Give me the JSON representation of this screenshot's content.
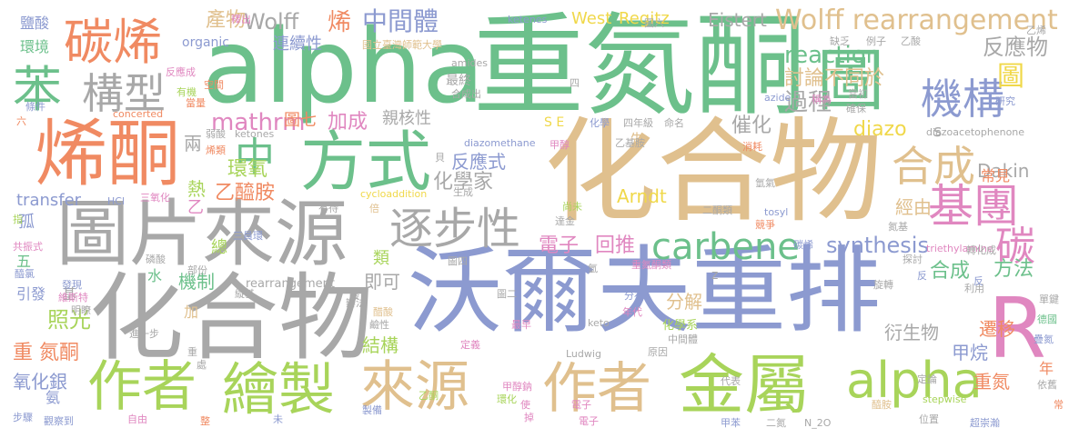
{
  "colors": {
    "green": "#6cc08b",
    "tan": "#e0c08e",
    "blue": "#8c9ad0",
    "gray": "#a8a8a8",
    "orange": "#f08a62",
    "pink": "#e087c0",
    "lime": "#a8d45a",
    "yellow": "#f0d84a"
  },
  "words": [
    {
      "text": "alpha",
      "color": "green"
    },
    {
      "text": "重氮酮",
      "color": "green"
    },
    {
      "text": "圖",
      "color": "green"
    },
    {
      "text": "化合物",
      "color": "tan"
    },
    {
      "text": "沃爾夫重排",
      "color": "blue"
    },
    {
      "text": "化合物",
      "color": "gray"
    },
    {
      "text": "圖片來源",
      "color": "gray"
    },
    {
      "text": "烯酮",
      "color": "orange"
    },
    {
      "text": "方式",
      "color": "green"
    },
    {
      "text": "碳烯",
      "color": "orange"
    },
    {
      "text": "苯",
      "color": "green"
    },
    {
      "text": "構型",
      "color": "gray"
    },
    {
      "text": "作者",
      "color": "lime"
    },
    {
      "text": "繪製",
      "color": "lime"
    },
    {
      "text": "來源",
      "color": "tan"
    },
    {
      "text": "作者",
      "color": "tan"
    },
    {
      "text": "金屬",
      "color": "lime"
    },
    {
      "text": "alpha",
      "color": "lime"
    },
    {
      "text": "R",
      "color": "pink"
    },
    {
      "text": "基團",
      "color": "pink"
    },
    {
      "text": "合成",
      "color": "tan"
    },
    {
      "text": "機構",
      "color": "blue"
    },
    {
      "text": "逐步性",
      "color": "gray"
    },
    {
      "text": "中",
      "color": "green"
    },
    {
      "text": "carbene",
      "color": "green"
    },
    {
      "text": "Wolff rearrangement",
      "color": "tan"
    },
    {
      "text": "碳",
      "color": "pink"
    },
    {
      "text": "反應物",
      "color": "gray"
    },
    {
      "text": "圖",
      "color": "yellow"
    },
    {
      "text": "Wolff",
      "color": "gray"
    },
    {
      "text": "產物",
      "color": "tan"
    },
    {
      "text": "烯",
      "color": "orange"
    },
    {
      "text": "中間體",
      "color": "blue"
    },
    {
      "text": "West",
      "color": "yellow"
    },
    {
      "text": "Regitz",
      "color": "yellow"
    },
    {
      "text": "Eistert",
      "color": "gray"
    },
    {
      "text": "reaction",
      "color": "green"
    },
    {
      "text": "mathrm",
      "color": "pink"
    },
    {
      "text": "加成",
      "color": "pink"
    },
    {
      "text": "過程",
      "color": "gray"
    },
    {
      "text": "討論不同於",
      "color": "tan"
    },
    {
      "text": "催化",
      "color": "gray"
    },
    {
      "text": "diazo",
      "color": "yellow"
    },
    {
      "text": "Dakin",
      "color": "gray"
    },
    {
      "text": "synthesis",
      "color": "blue"
    },
    {
      "text": "電子",
      "color": "pink"
    },
    {
      "text": "回推",
      "color": "pink"
    },
    {
      "text": "化學家",
      "color": "gray"
    },
    {
      "text": "反應式",
      "color": "blue"
    },
    {
      "text": "乙醯胺",
      "color": "orange"
    },
    {
      "text": "環氧",
      "color": "lime"
    },
    {
      "text": "Arndt",
      "color": "yellow"
    },
    {
      "text": "合成",
      "color": "green"
    },
    {
      "text": "方法",
      "color": "green"
    },
    {
      "text": "transfer",
      "color": "blue"
    },
    {
      "text": "照光",
      "color": "lime"
    },
    {
      "text": "重 氮酮",
      "color": "orange"
    },
    {
      "text": "氧化銀",
      "color": "blue"
    },
    {
      "text": "機制",
      "color": "green"
    },
    {
      "text": "即可",
      "color": "gray"
    },
    {
      "text": "分解",
      "color": "tan"
    },
    {
      "text": "結構",
      "color": "lime"
    },
    {
      "text": "衍生物",
      "color": "gray"
    },
    {
      "text": "甲烷",
      "color": "blue"
    },
    {
      "text": "遷移",
      "color": "orange"
    },
    {
      "text": "重氮",
      "color": "orange"
    },
    {
      "text": "常見",
      "color": "orange"
    },
    {
      "text": "經由",
      "color": "tan"
    },
    {
      "text": "環境",
      "color": "green"
    },
    {
      "text": "鹽酸",
      "color": "blue"
    },
    {
      "text": "連續性",
      "color": "blue"
    },
    {
      "text": "國立臺灣師範大學",
      "color": "tan"
    },
    {
      "text": "organic",
      "color": "blue"
    },
    {
      "text": "親核性",
      "color": "gray"
    },
    {
      "text": "圖七",
      "color": "orange"
    },
    {
      "text": "最終",
      "color": "gray"
    },
    {
      "text": "ketenes",
      "color": "blue"
    },
    {
      "text": "diazomethane",
      "color": "blue"
    },
    {
      "text": "ketones",
      "color": "gray"
    },
    {
      "text": "diazoacetophenone",
      "color": "gray"
    },
    {
      "text": "rearrangement",
      "color": "gray"
    },
    {
      "text": "cycloaddition",
      "color": "yellow"
    },
    {
      "text": "amides",
      "color": "gray"
    },
    {
      "text": "concerted",
      "color": "orange"
    },
    {
      "text": "tosyl",
      "color": "blue"
    },
    {
      "text": "triethylamine",
      "color": "pink"
    },
    {
      "text": "stepwise",
      "color": "lime"
    },
    {
      "text": "azide",
      "color": "blue"
    },
    {
      "text": "Ludwig",
      "color": "gray"
    },
    {
      "text": "keto",
      "color": "gray"
    },
    {
      "text": "N_2O",
      "color": "gray"
    },
    {
      "text": "HCl",
      "color": "blue"
    },
    {
      "text": "兩",
      "color": "gray"
    },
    {
      "text": "熱",
      "color": "lime"
    },
    {
      "text": "乙",
      "color": "pink"
    },
    {
      "text": "孤",
      "color": "blue"
    },
    {
      "text": "五",
      "color": "green"
    },
    {
      "text": "水",
      "color": "green"
    },
    {
      "text": "總",
      "color": "lime"
    },
    {
      "text": "類",
      "color": "lime"
    },
    {
      "text": "加",
      "color": "tan"
    },
    {
      "text": "基",
      "color": "gray"
    },
    {
      "text": "引發",
      "color": "blue"
    },
    {
      "text": "氨",
      "color": "blue"
    },
    {
      "text": "年",
      "color": "orange"
    },
    {
      "text": "s",
      "color": "gray"
    },
    {
      "text": "S E",
      "color": "yellow"
    },
    {
      "text": "先",
      "color": "tan"
    },
    {
      "text": "z",
      "color": "gray"
    },
    {
      "text": "當量",
      "color": "orange"
    },
    {
      "text": "有機",
      "color": "lime"
    },
    {
      "text": "條件",
      "color": "blue"
    },
    {
      "text": "反應成",
      "color": "pink"
    },
    {
      "text": "空間",
      "color": "orange"
    },
    {
      "text": "合成出",
      "color": "gray"
    },
    {
      "text": "弱酸",
      "color": "gray"
    },
    {
      "text": "烯類",
      "color": "orange"
    },
    {
      "text": "四年級",
      "color": "gray"
    },
    {
      "text": "化學",
      "color": "blue"
    },
    {
      "text": "命名",
      "color": "gray"
    },
    {
      "text": "乙基胺",
      "color": "gray"
    },
    {
      "text": "消耗",
      "color": "orange"
    },
    {
      "text": "稱為",
      "color": "pink"
    },
    {
      "text": "研究",
      "color": "blue"
    },
    {
      "text": "當初",
      "color": "gray"
    },
    {
      "text": "確保",
      "color": "gray"
    },
    {
      "text": "缺乏",
      "color": "gray"
    },
    {
      "text": "例子",
      "color": "gray"
    },
    {
      "text": "乙酸",
      "color": "gray"
    },
    {
      "text": "氫氣",
      "color": "gray"
    },
    {
      "text": "氮基",
      "color": "gray"
    },
    {
      "text": "轉化成",
      "color": "gray"
    },
    {
      "text": "探討",
      "color": "gray"
    },
    {
      "text": "反",
      "color": "blue"
    },
    {
      "text": "單鍵",
      "color": "gray"
    },
    {
      "text": "德國",
      "color": "green"
    },
    {
      "text": "疊氮",
      "color": "blue"
    },
    {
      "text": "依舊",
      "color": "gray"
    },
    {
      "text": "利用",
      "color": "gray"
    },
    {
      "text": "旋轉",
      "color": "gray"
    },
    {
      "text": "定論",
      "color": "gray"
    },
    {
      "text": "位置",
      "color": "gray"
    },
    {
      "text": "醯胺",
      "color": "tan"
    },
    {
      "text": "超崇瀚",
      "color": "blue"
    },
    {
      "text": "甲苯",
      "color": "blue"
    },
    {
      "text": "二氮",
      "color": "gray"
    },
    {
      "text": "重氮酮類",
      "color": "pink"
    },
    {
      "text": "分布",
      "color": "blue"
    },
    {
      "text": "年代",
      "color": "pink"
    },
    {
      "text": "中間體",
      "color": "gray"
    },
    {
      "text": "原因",
      "color": "gray"
    },
    {
      "text": "代表",
      "color": "gray"
    },
    {
      "text": "電子",
      "color": "pink"
    },
    {
      "text": "化學系",
      "color": "lime"
    },
    {
      "text": "最早",
      "color": "pink"
    },
    {
      "text": "甲醇鈉",
      "color": "pink"
    },
    {
      "text": "環化",
      "color": "lime"
    },
    {
      "text": "乙酮",
      "color": "lime"
    },
    {
      "text": "定義",
      "color": "pink"
    },
    {
      "text": "製備",
      "color": "blue"
    },
    {
      "text": "鹼性",
      "color": "gray"
    },
    {
      "text": "醋酸",
      "color": "tan"
    },
    {
      "text": "圖四",
      "color": "gray"
    },
    {
      "text": "圖二",
      "color": "gray"
    },
    {
      "text": "辦法",
      "color": "gray"
    },
    {
      "text": "發現",
      "color": "blue"
    },
    {
      "text": "維斯特",
      "color": "pink"
    },
    {
      "text": "明瞭",
      "color": "gray"
    },
    {
      "text": "部份",
      "color": "gray"
    },
    {
      "text": "磷酸",
      "color": "gray"
    },
    {
      "text": "醯氯",
      "color": "blue"
    },
    {
      "text": "共振式",
      "color": "pink"
    },
    {
      "text": "指",
      "color": "lime"
    },
    {
      "text": "步驟",
      "color": "blue"
    },
    {
      "text": "觀察到",
      "color": "blue"
    },
    {
      "text": "自由",
      "color": "pink"
    },
    {
      "text": "進一步",
      "color": "gray"
    },
    {
      "text": "三氧化",
      "color": "pink"
    },
    {
      "text": "三員環",
      "color": "blue"
    },
    {
      "text": "有待",
      "color": "gray"
    },
    {
      "text": "倍",
      "color": "tan"
    },
    {
      "text": "生成",
      "color": "gray"
    },
    {
      "text": "尚未",
      "color": "lime"
    },
    {
      "text": "達金",
      "color": "gray"
    },
    {
      "text": "二酮類",
      "color": "gray"
    },
    {
      "text": "競爭",
      "color": "orange"
    },
    {
      "text": "碳烯",
      "color": "blue"
    },
    {
      "text": "甲醇",
      "color": "pink"
    },
    {
      "text": "貝",
      "color": "gray"
    },
    {
      "text": "酸",
      "color": "gray"
    },
    {
      "text": "氫",
      "color": "gray"
    },
    {
      "text": "處",
      "color": "gray"
    },
    {
      "text": "重",
      "color": "gray"
    },
    {
      "text": "使",
      "color": "pink"
    },
    {
      "text": "掉",
      "color": "pink"
    },
    {
      "text": "整",
      "color": "orange"
    },
    {
      "text": "常",
      "color": "orange"
    },
    {
      "text": "六",
      "color": "orange"
    },
    {
      "text": "圖六",
      "color": "gray"
    },
    {
      "text": "釋出",
      "color": "pink"
    },
    {
      "text": "四",
      "color": "gray"
    },
    {
      "text": "乙烯",
      "color": "gray"
    },
    {
      "text": "縱基",
      "color": "gray"
    },
    {
      "text": "未",
      "color": "blue"
    },
    {
      "text": "電子",
      "color": "pink"
    },
    {
      "text": "反",
      "color": "blue"
    }
  ]
}
